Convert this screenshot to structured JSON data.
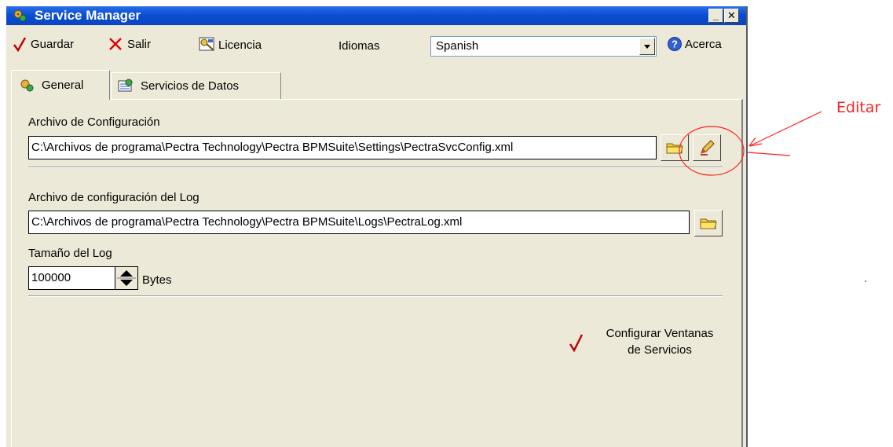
{
  "window": {
    "title": "Service Manager"
  },
  "toolbar": {
    "save_label": "Guardar",
    "exit_label": "Salir",
    "license_label": "Licencia",
    "languages_label": "Idiomas",
    "language_value": "Spanish",
    "about_label": "Acerca"
  },
  "tabs": [
    {
      "label": "General"
    },
    {
      "label": "Servicios de Datos"
    }
  ],
  "general": {
    "config_label": "Archivo de Configuración",
    "config_path": "C:\\Archivos de programa\\Pectra Technology\\Pectra BPMSuite\\Settings\\PectraSvcConfig.xml",
    "log_config_label": "Archivo de configuración del Log",
    "log_config_path": "C:\\Archivos de programa\\Pectra Technology\\Pectra BPMSuite\\Logs\\PectraLog.xml",
    "log_size_label": "Tamaño del Log",
    "log_size_value": "100000",
    "log_size_unit": "Bytes",
    "configure_windows_line1": "Configurar Ventanas",
    "configure_windows_line2": "de Servicios"
  },
  "annotation": {
    "text": "Editar",
    "color": "#ff2020"
  },
  "colors": {
    "titlebar": "#0a4fd3",
    "check": "#c00000",
    "window_bg": "#ece9d8"
  }
}
